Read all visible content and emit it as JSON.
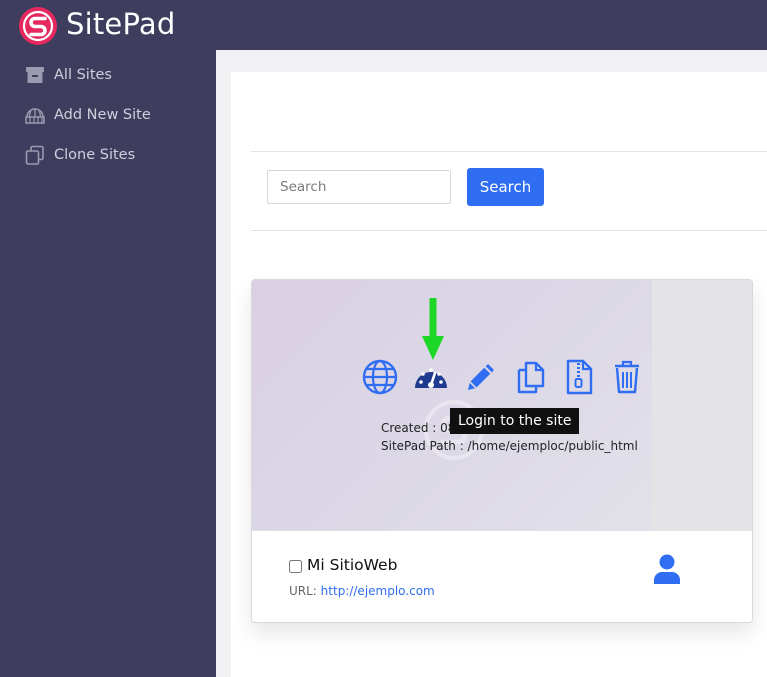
{
  "app": {
    "brand": "SitePad",
    "brand_color": "#e5295e",
    "topbar_color": "#3f3d5e"
  },
  "sidebar": {
    "items": [
      {
        "label": "All Sites",
        "icon": "archive-icon"
      },
      {
        "label": "Add New Site",
        "icon": "globe-grid-icon"
      },
      {
        "label": "Clone Sites",
        "icon": "clone-icon"
      }
    ]
  },
  "search": {
    "placeholder": "Search",
    "value": "",
    "button_label": "Search"
  },
  "site_card": {
    "actions": [
      {
        "name": "view-site",
        "icon": "globe-icon"
      },
      {
        "name": "login",
        "icon": "dashboard-gauge-icon"
      },
      {
        "name": "edit",
        "icon": "pencil-icon"
      },
      {
        "name": "clone",
        "icon": "copy-icon"
      },
      {
        "name": "backup",
        "icon": "zip-file-icon"
      },
      {
        "name": "delete",
        "icon": "trash-icon"
      }
    ],
    "created_text": "Created : 08",
    "path_text": "SitePad Path : /home/ejemploc/public_html",
    "tooltip": "Login to the site",
    "site_name": "Mi SitioWeb",
    "url_label": "URL: ",
    "url": "http://ejemplo.com",
    "accent_color": "#2f6ef2",
    "arrow_color": "#1ed626"
  }
}
